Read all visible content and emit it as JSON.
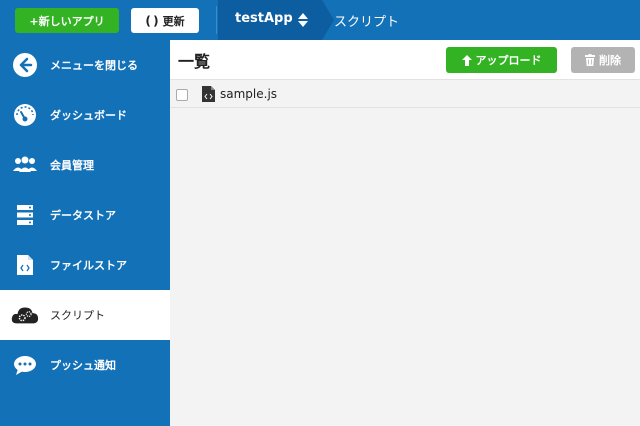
{
  "header": {
    "new_app_label": "+新しいアプリ",
    "refresh_label": "更新",
    "app_name": "testApp",
    "breadcrumb": "スクリプト"
  },
  "sidebar": {
    "items": [
      {
        "label": "メニューを閉じる",
        "icon": "back-arrow-icon",
        "active": false
      },
      {
        "label": "ダッシュボード",
        "icon": "dashboard-gauge-icon",
        "active": false
      },
      {
        "label": "会員管理",
        "icon": "users-icon",
        "active": false
      },
      {
        "label": "データストア",
        "icon": "database-icon",
        "active": false
      },
      {
        "label": "ファイルストア",
        "icon": "code-file-icon",
        "active": false
      },
      {
        "label": "スクリプト",
        "icon": "cloud-gears-icon",
        "active": true
      },
      {
        "label": "プッシュ通知",
        "icon": "chat-bubble-icon",
        "active": false
      }
    ]
  },
  "content": {
    "title": "一覧",
    "upload_label": "アップロード",
    "delete_label": "削除",
    "files": [
      {
        "name": "sample.js",
        "checked": false
      }
    ]
  },
  "colors": {
    "primary": "#1371b8",
    "green": "#33b324",
    "disabled": "#b3b3b3"
  }
}
